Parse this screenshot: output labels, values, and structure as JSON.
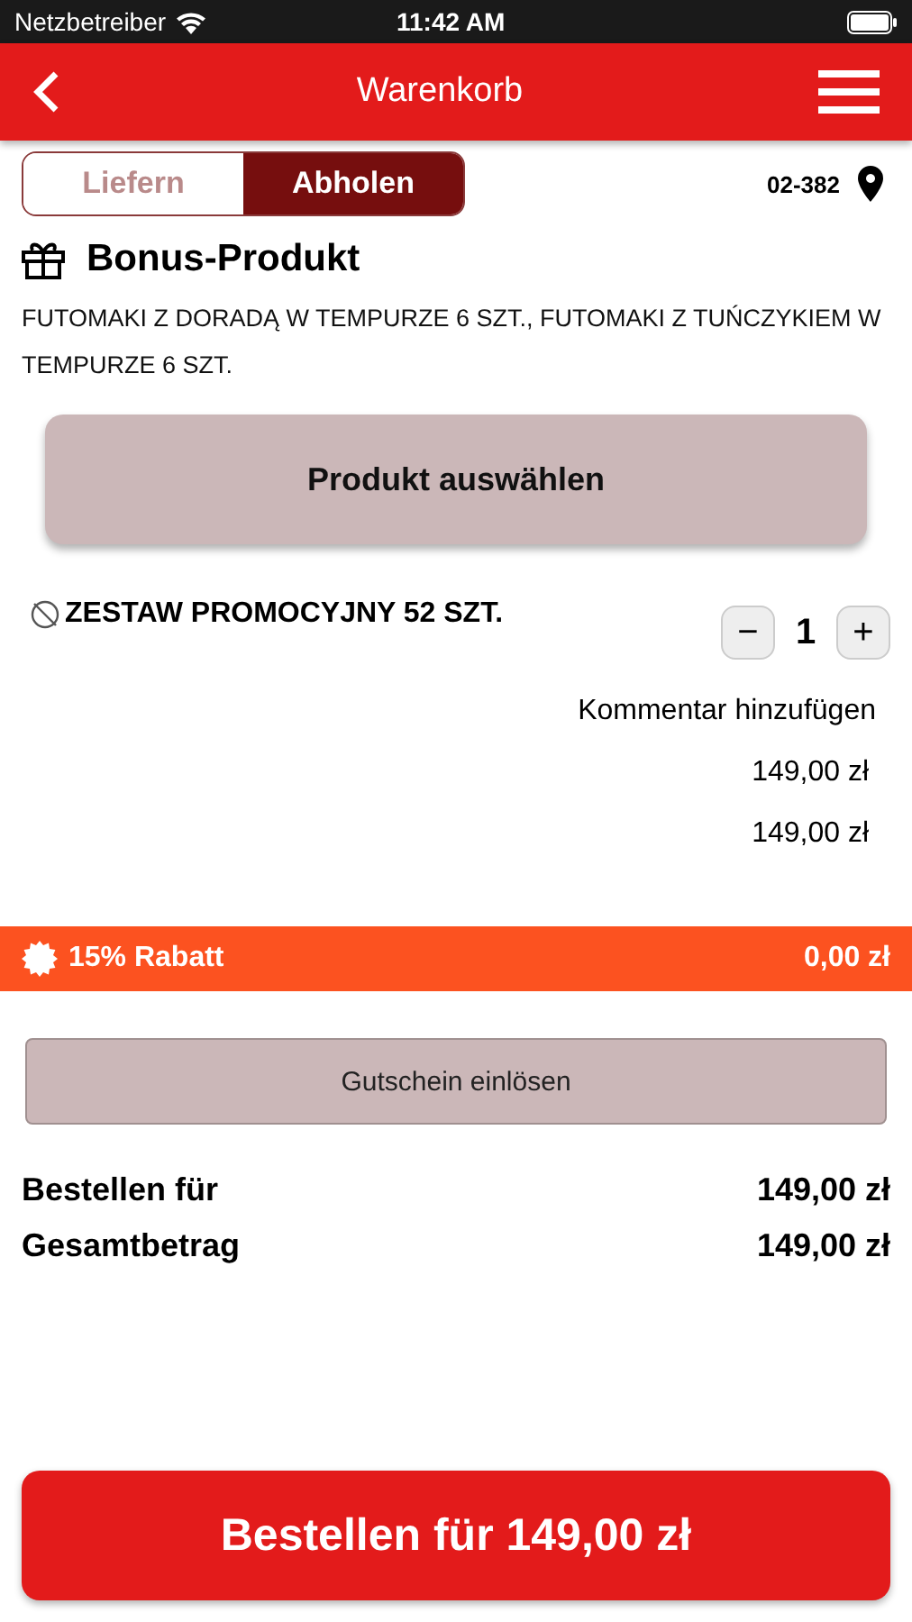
{
  "status_bar": {
    "carrier": "Netzbetreiber",
    "time": "11:42 AM"
  },
  "header": {
    "title": "Warenkorb"
  },
  "tabs": [
    {
      "label": "Liefern",
      "selected": false
    },
    {
      "label": "Abholen",
      "selected": true
    }
  ],
  "location": {
    "postcode": "02-382"
  },
  "bonus": {
    "title": "Bonus-Produkt",
    "description": "FUTOMAKI Z DORADĄ W TEMPURZE 6 SZT., FUTOMAKI Z TUŃCZYKIEM W TEMPURZE 6 SZT.",
    "button": "Produkt auswählen"
  },
  "items": [
    {
      "name": "ZESTAW PROMOCYJNY 52 SZT.",
      "quantity": "1",
      "minus": "−",
      "plus": "+",
      "comment_link": "Kommentar hinzufügen",
      "unit_price": "149,00 zł",
      "total_price": "149,00 zł"
    }
  ],
  "discount": {
    "label": "15% Rabatt",
    "amount": "0,00 zł"
  },
  "voucher_button": "Gutschein einlösen",
  "totals": [
    {
      "label": "Bestellen für",
      "value": "149,00 zł"
    },
    {
      "label": "Gesamtbetrag",
      "value": "149,00 zł"
    }
  ],
  "order_button": "Bestellen für 149,00 zł"
}
